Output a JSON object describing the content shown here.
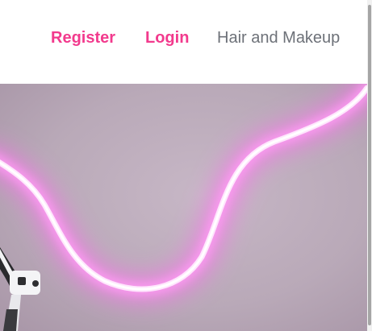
{
  "nav": {
    "register_label": "Register",
    "login_label": "Login",
    "category_label": "Hair and Makeup"
  },
  "colors": {
    "accent": "#f23a8d",
    "nav_text": "#6d7178",
    "hero_background": "#b9a8b8",
    "neon": "#ff7bf0"
  },
  "hero": {
    "image": "neon-light-tube-icon"
  }
}
